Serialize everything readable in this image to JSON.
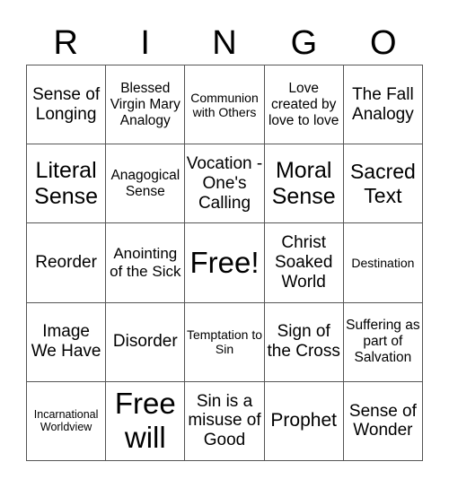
{
  "header": {
    "letters": [
      "R",
      "I",
      "N",
      "G",
      "O"
    ]
  },
  "cells": [
    {
      "text": "Sense of Longing",
      "size": "s19"
    },
    {
      "text": "Blessed Virgin Mary Analogy",
      "size": "s15"
    },
    {
      "text": "Communion with Others",
      "size": "s13"
    },
    {
      "text": "Love created by love to love",
      "size": "s15"
    },
    {
      "text": "The Fall Analogy",
      "size": "s19"
    },
    {
      "text": "Literal Sense",
      "size": "s25"
    },
    {
      "text": "Anagogical Sense",
      "size": "s15"
    },
    {
      "text": "Vocation - One's Calling",
      "size": "s19"
    },
    {
      "text": "Moral Sense",
      "size": "s25"
    },
    {
      "text": "Sacred Text",
      "size": "s23"
    },
    {
      "text": "Reorder",
      "size": "s19"
    },
    {
      "text": "Anointing of the Sick",
      "size": "s17"
    },
    {
      "text": "Free!",
      "size": "s33"
    },
    {
      "text": "Christ Soaked World",
      "size": "s19"
    },
    {
      "text": "Destination",
      "size": "s13"
    },
    {
      "text": "Image We Have",
      "size": "s19"
    },
    {
      "text": "Disorder",
      "size": "s19"
    },
    {
      "text": "Temptation to Sin",
      "size": "s13"
    },
    {
      "text": "Sign of the Cross",
      "size": "s19"
    },
    {
      "text": "Suffering as part of Salvation",
      "size": "s15"
    },
    {
      "text": "Incarnational Worldview",
      "size": "s12"
    },
    {
      "text": "Free will",
      "size": "s33"
    },
    {
      "text": "Sin is a misuse of Good",
      "size": "s19"
    },
    {
      "text": "Prophet",
      "size": "s21"
    },
    {
      "text": "Sense of Wonder",
      "size": "s19"
    }
  ]
}
